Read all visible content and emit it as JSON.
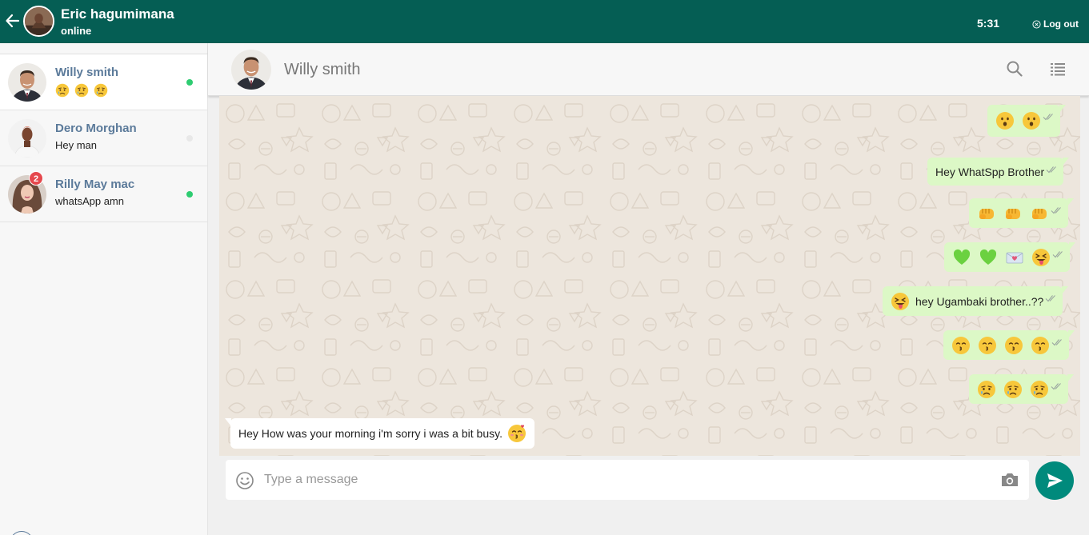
{
  "user": {
    "name": "Eric hagumimana",
    "status": "online"
  },
  "topbar": {
    "time": "5:31",
    "logout_label": "Log out"
  },
  "contacts": [
    {
      "name": "Willy smith",
      "preview_emojis": [
        "sad",
        "sad",
        "sad"
      ],
      "online": true,
      "active": true
    },
    {
      "name": "Dero Morghan",
      "preview": "Hey man",
      "online": false
    },
    {
      "name": "Rilly May mac",
      "preview": "whatsApp amn",
      "online": true,
      "unread": "2"
    }
  ],
  "chat": {
    "contact_name": "Willy smith"
  },
  "messages": [
    {
      "dir": "out",
      "emojis": [
        "surprised",
        "surprised"
      ]
    },
    {
      "dir": "out",
      "text": "Hey WhatSpp Brother"
    },
    {
      "dir": "out",
      "emojis": [
        "fist",
        "fist",
        "fist"
      ]
    },
    {
      "dir": "out",
      "emojis": [
        "green-heart",
        "green-heart",
        "love-letter",
        "tongue"
      ]
    },
    {
      "dir": "out",
      "text": "hey Ugambaki brother..??",
      "lead_emoji": "tongue"
    },
    {
      "dir": "out",
      "emojis": [
        "kiss",
        "kiss",
        "kiss",
        "kiss"
      ]
    },
    {
      "dir": "out",
      "emojis": [
        "sad",
        "sad",
        "sad"
      ]
    },
    {
      "dir": "in",
      "text": "Hey How was your morning i'm sorry i was a bit busy.",
      "trail_emoji": "kiss-blush"
    }
  ],
  "composer": {
    "placeholder": "Type a message"
  },
  "colors": {
    "header": "#055e54",
    "outgoing_bubble": "#dcf8c6",
    "send_button": "#008a7c",
    "online_dot": "#2ecc71",
    "badge": "#e5484d"
  }
}
